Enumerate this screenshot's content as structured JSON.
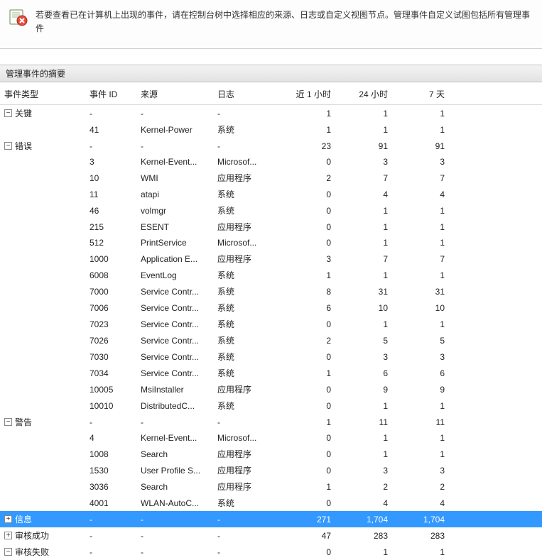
{
  "banner": {
    "text": "若要查看已在计算机上出现的事件，请在控制台树中选择相应的来源、日志或自定义视图节点。管理事件自定义试图包括所有管理事件"
  },
  "section": {
    "title": "管理事件的摘要"
  },
  "columns": {
    "type": "事件类型",
    "id": "事件 ID",
    "source": "来源",
    "log": "日志",
    "h1": "近 1 小时",
    "h24": "24 小时",
    "d7": "7 天"
  },
  "rows": [
    {
      "group": true,
      "expanded": true,
      "label": "关键",
      "id": "-",
      "source": "-",
      "log": "-",
      "h1": "1",
      "h24": "1",
      "d7": "1"
    },
    {
      "group": false,
      "label": "",
      "id": "41",
      "source": "Kernel-Power",
      "log": "系统",
      "h1": "1",
      "h24": "1",
      "d7": "1"
    },
    {
      "group": true,
      "expanded": true,
      "label": "错误",
      "id": "-",
      "source": "-",
      "log": "-",
      "h1": "23",
      "h24": "91",
      "d7": "91"
    },
    {
      "group": false,
      "label": "",
      "id": "3",
      "source": "Kernel-Event...",
      "log": "Microsof...",
      "h1": "0",
      "h24": "3",
      "d7": "3"
    },
    {
      "group": false,
      "label": "",
      "id": "10",
      "source": "WMI",
      "log": "应用程序",
      "h1": "2",
      "h24": "7",
      "d7": "7"
    },
    {
      "group": false,
      "label": "",
      "id": "11",
      "source": "atapi",
      "log": "系统",
      "h1": "0",
      "h24": "4",
      "d7": "4"
    },
    {
      "group": false,
      "label": "",
      "id": "46",
      "source": "volmgr",
      "log": "系统",
      "h1": "0",
      "h24": "1",
      "d7": "1"
    },
    {
      "group": false,
      "label": "",
      "id": "215",
      "source": "ESENT",
      "log": "应用程序",
      "h1": "0",
      "h24": "1",
      "d7": "1"
    },
    {
      "group": false,
      "label": "",
      "id": "512",
      "source": "PrintService",
      "log": "Microsof...",
      "h1": "0",
      "h24": "1",
      "d7": "1"
    },
    {
      "group": false,
      "label": "",
      "id": "1000",
      "source": "Application E...",
      "log": "应用程序",
      "h1": "3",
      "h24": "7",
      "d7": "7"
    },
    {
      "group": false,
      "label": "",
      "id": "6008",
      "source": "EventLog",
      "log": "系统",
      "h1": "1",
      "h24": "1",
      "d7": "1"
    },
    {
      "group": false,
      "label": "",
      "id": "7000",
      "source": "Service Contr...",
      "log": "系统",
      "h1": "8",
      "h24": "31",
      "d7": "31"
    },
    {
      "group": false,
      "label": "",
      "id": "7006",
      "source": "Service Contr...",
      "log": "系统",
      "h1": "6",
      "h24": "10",
      "d7": "10"
    },
    {
      "group": false,
      "label": "",
      "id": "7023",
      "source": "Service Contr...",
      "log": "系统",
      "h1": "0",
      "h24": "1",
      "d7": "1"
    },
    {
      "group": false,
      "label": "",
      "id": "7026",
      "source": "Service Contr...",
      "log": "系统",
      "h1": "2",
      "h24": "5",
      "d7": "5"
    },
    {
      "group": false,
      "label": "",
      "id": "7030",
      "source": "Service Contr...",
      "log": "系统",
      "h1": "0",
      "h24": "3",
      "d7": "3"
    },
    {
      "group": false,
      "label": "",
      "id": "7034",
      "source": "Service Contr...",
      "log": "系统",
      "h1": "1",
      "h24": "6",
      "d7": "6"
    },
    {
      "group": false,
      "label": "",
      "id": "10005",
      "source": "MsiInstaller",
      "log": "应用程序",
      "h1": "0",
      "h24": "9",
      "d7": "9"
    },
    {
      "group": false,
      "label": "",
      "id": "10010",
      "source": "DistributedC...",
      "log": "系统",
      "h1": "0",
      "h24": "1",
      "d7": "1"
    },
    {
      "group": true,
      "expanded": true,
      "label": "警告",
      "id": "-",
      "source": "-",
      "log": "-",
      "h1": "1",
      "h24": "11",
      "d7": "11"
    },
    {
      "group": false,
      "label": "",
      "id": "4",
      "source": "Kernel-Event...",
      "log": "Microsof...",
      "h1": "0",
      "h24": "1",
      "d7": "1"
    },
    {
      "group": false,
      "label": "",
      "id": "1008",
      "source": "Search",
      "log": "应用程序",
      "h1": "0",
      "h24": "1",
      "d7": "1"
    },
    {
      "group": false,
      "label": "",
      "id": "1530",
      "source": "User Profile S...",
      "log": "应用程序",
      "h1": "0",
      "h24": "3",
      "d7": "3"
    },
    {
      "group": false,
      "label": "",
      "id": "3036",
      "source": "Search",
      "log": "应用程序",
      "h1": "1",
      "h24": "2",
      "d7": "2"
    },
    {
      "group": false,
      "label": "",
      "id": "4001",
      "source": "WLAN-AutoC...",
      "log": "系统",
      "h1": "0",
      "h24": "4",
      "d7": "4"
    },
    {
      "group": true,
      "expanded": false,
      "selected": true,
      "label": "信息",
      "id": "-",
      "source": "-",
      "log": "-",
      "h1": "271",
      "h24": "1,704",
      "d7": "1,704"
    },
    {
      "group": true,
      "expanded": false,
      "label": "审核成功",
      "id": "-",
      "source": "-",
      "log": "-",
      "h1": "47",
      "h24": "283",
      "d7": "283"
    },
    {
      "group": true,
      "expanded": true,
      "label": "审核失败",
      "id": "-",
      "source": "-",
      "log": "-",
      "h1": "0",
      "h24": "1",
      "d7": "1"
    }
  ]
}
